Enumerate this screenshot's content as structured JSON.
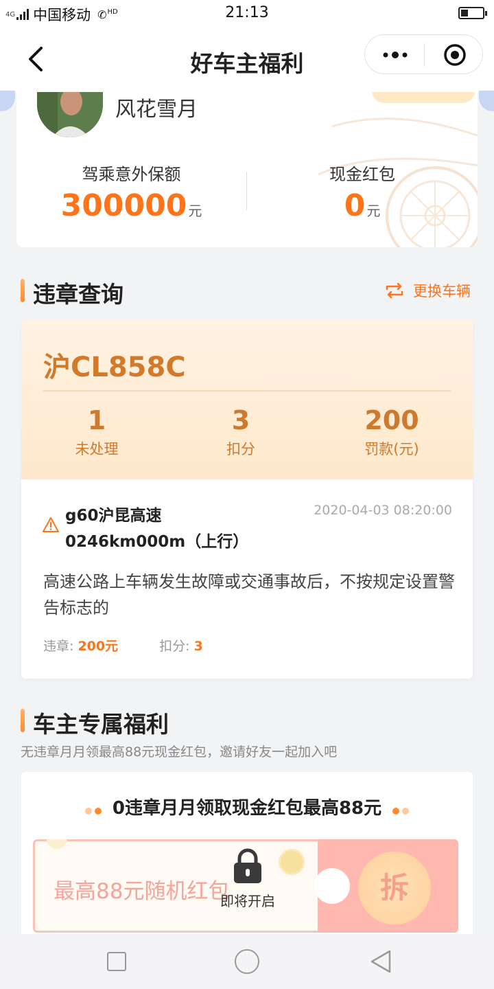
{
  "status_bar": {
    "signal_label": "4G",
    "carrier": "中国移动",
    "call_icon": "phone-hd-icon",
    "hd_label": "HD",
    "time": "21:13"
  },
  "navbar": {
    "title": "好车主福利"
  },
  "profile": {
    "name": "风花雪月",
    "insurance_label": "驾乘意外保额",
    "insurance_value": "300000",
    "insurance_unit": "元",
    "cash_label": "现金红包",
    "cash_value": "0",
    "cash_unit": "元"
  },
  "violation_section": {
    "title": "违章查询",
    "switch_label": "更换车辆",
    "plate": "沪CL858C",
    "stats": [
      {
        "value": "1",
        "label": "未处理"
      },
      {
        "value": "3",
        "label": "扣分"
      },
      {
        "value": "200",
        "label": "罚款(元)"
      }
    ],
    "record": {
      "road_line1": "g60沪昆高速",
      "road_line2": "0246km000m（上行）",
      "time": "2020-04-03 08:20:00",
      "description": "高速公路上车辆发生故障或交通事故后，不按规定设置警告标志的",
      "fine_label": "违章: ",
      "fine_value": "200元",
      "points_label": "扣分: ",
      "points_value": "3"
    }
  },
  "benefit_section": {
    "title": "车主专属福利",
    "subtitle": "无违章月月领最高88元现金红包，邀请好友一起加入吧",
    "card_title": "0违章月月领取现金红包最高88元",
    "coupon_slogan": "最高88元随机红包",
    "lock_text": "即将开启",
    "open_button": "拆"
  },
  "colors": {
    "accent": "#ff7418",
    "plate_brown": "#cd7a2e"
  }
}
